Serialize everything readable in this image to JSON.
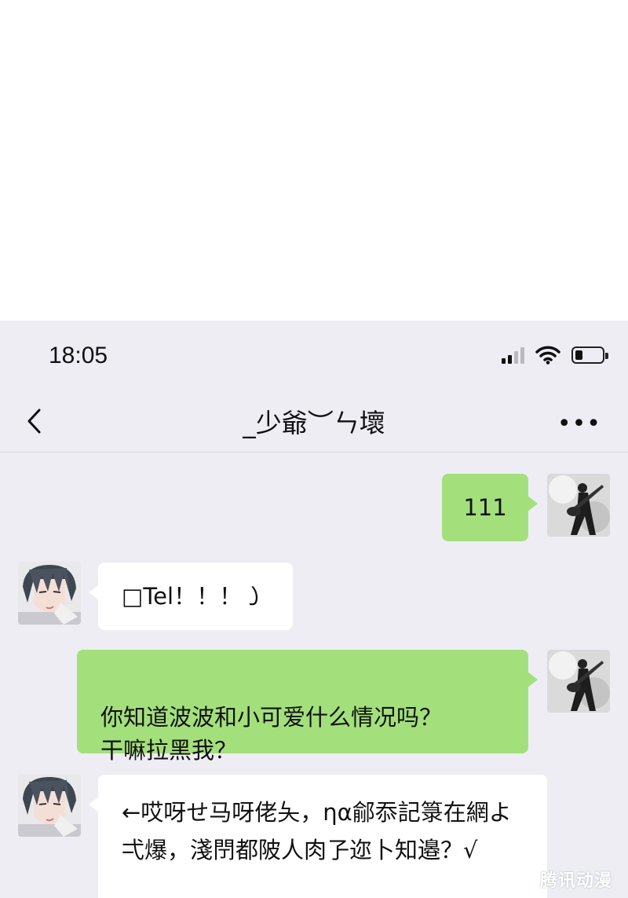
{
  "status_bar": {
    "time": "18:05",
    "signal_bars": 4,
    "signal_active_bars": 2,
    "battery_level": 0.25
  },
  "nav": {
    "back_icon": "chevron-left-icon",
    "title": "_少爺︶ㄣ壞",
    "more_label": "•••"
  },
  "messages": [
    {
      "direction": "outgoing",
      "text": "111",
      "avatar": "guitarist-avatar"
    },
    {
      "direction": "incoming",
      "text": "□Tel！！！㇁",
      "avatar": "anime-boy-avatar"
    },
    {
      "direction": "outgoing",
      "text": "你知道波波和小可爱什么情况吗？\n干嘛拉黑我？",
      "avatar": "guitarist-avatar"
    },
    {
      "direction": "incoming",
      "text": "←哎呀せ马呀佬夨，ηα鄃忝記箓在網よ弌爆，淺閅都陂人肉孒迩卜知邉？√",
      "avatar": "anime-boy-avatar"
    }
  ],
  "watermark": "腾讯动漫",
  "colors": {
    "outgoing_bubble": "#a3e07c",
    "incoming_bubble": "#ffffff",
    "chat_background": "#ededf3"
  }
}
